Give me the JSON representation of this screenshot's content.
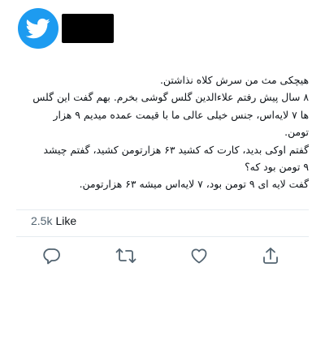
{
  "header": {
    "avatar_icon": "twitter-bird-icon",
    "brand_color": "#1d9bf0"
  },
  "tweet": {
    "lines": [
      "هیچکی مث من سرش کلاه نذاشتن.",
      "۸ سال پیش رفتم علاءالدین گلس گوشی بخرم. بهم گفت این گلس",
      "ها ۷ لایه‌اس، جنس خیلی عالی ما با  قیمت عمده میدیم ۹ هزار",
      "تومن.",
      "گفتم اوکی بدید، کارت که کشید ۶۳ هزارتومن کشید، گفتم چیشد",
      "۹ تومن بود که؟",
      "گفت لایه ای ۹ تومن بود، ۷ لایه‌اس میشه ۶۳ هزارتومن."
    ]
  },
  "stats": {
    "likes_count": "2.5k",
    "likes_label": "Like"
  },
  "actions": {
    "reply_icon": "reply-icon",
    "retweet_icon": "retweet-icon",
    "like_icon": "heart-icon",
    "share_icon": "share-icon",
    "icon_color": "#536471"
  }
}
